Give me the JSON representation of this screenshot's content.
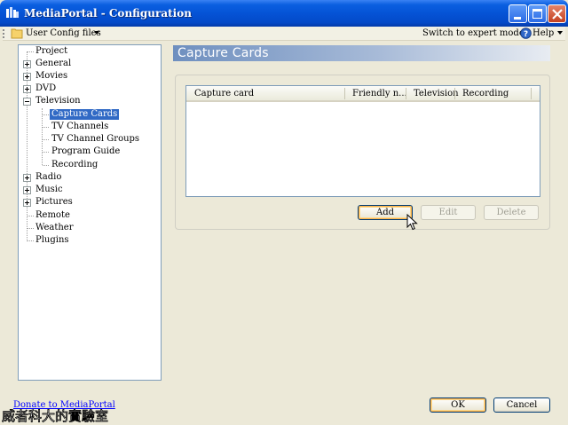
{
  "window": {
    "title": "MediaPortal - Configuration"
  },
  "toolbar": {
    "config_label": "User Config files",
    "expert_label": "Switch to expert mode",
    "help_label": "Help"
  },
  "tree": {
    "items": [
      {
        "label": "Project"
      },
      {
        "label": "General"
      },
      {
        "label": "Movies"
      },
      {
        "label": "DVD"
      },
      {
        "label": "Television"
      },
      {
        "label": "Capture Cards"
      },
      {
        "label": "TV Channels"
      },
      {
        "label": "TV Channel Groups"
      },
      {
        "label": "Program Guide"
      },
      {
        "label": "Recording"
      },
      {
        "label": "Radio"
      },
      {
        "label": "Music"
      },
      {
        "label": "Pictures"
      },
      {
        "label": "Remote"
      },
      {
        "label": "Weather"
      },
      {
        "label": "Plugins"
      }
    ],
    "selected": "Capture Cards"
  },
  "main": {
    "header": "Capture Cards",
    "columns": [
      "Capture card",
      "Friendly n...",
      "Television",
      "Recording"
    ],
    "rows": [],
    "add_label": "Add",
    "edit_label": "Edit",
    "delete_label": "Delete"
  },
  "footer": {
    "donate_link": "Donate to MediaPortal",
    "ok_label": "OK",
    "cancel_label": "Cancel",
    "watermark": "威者科大的實驗室"
  }
}
